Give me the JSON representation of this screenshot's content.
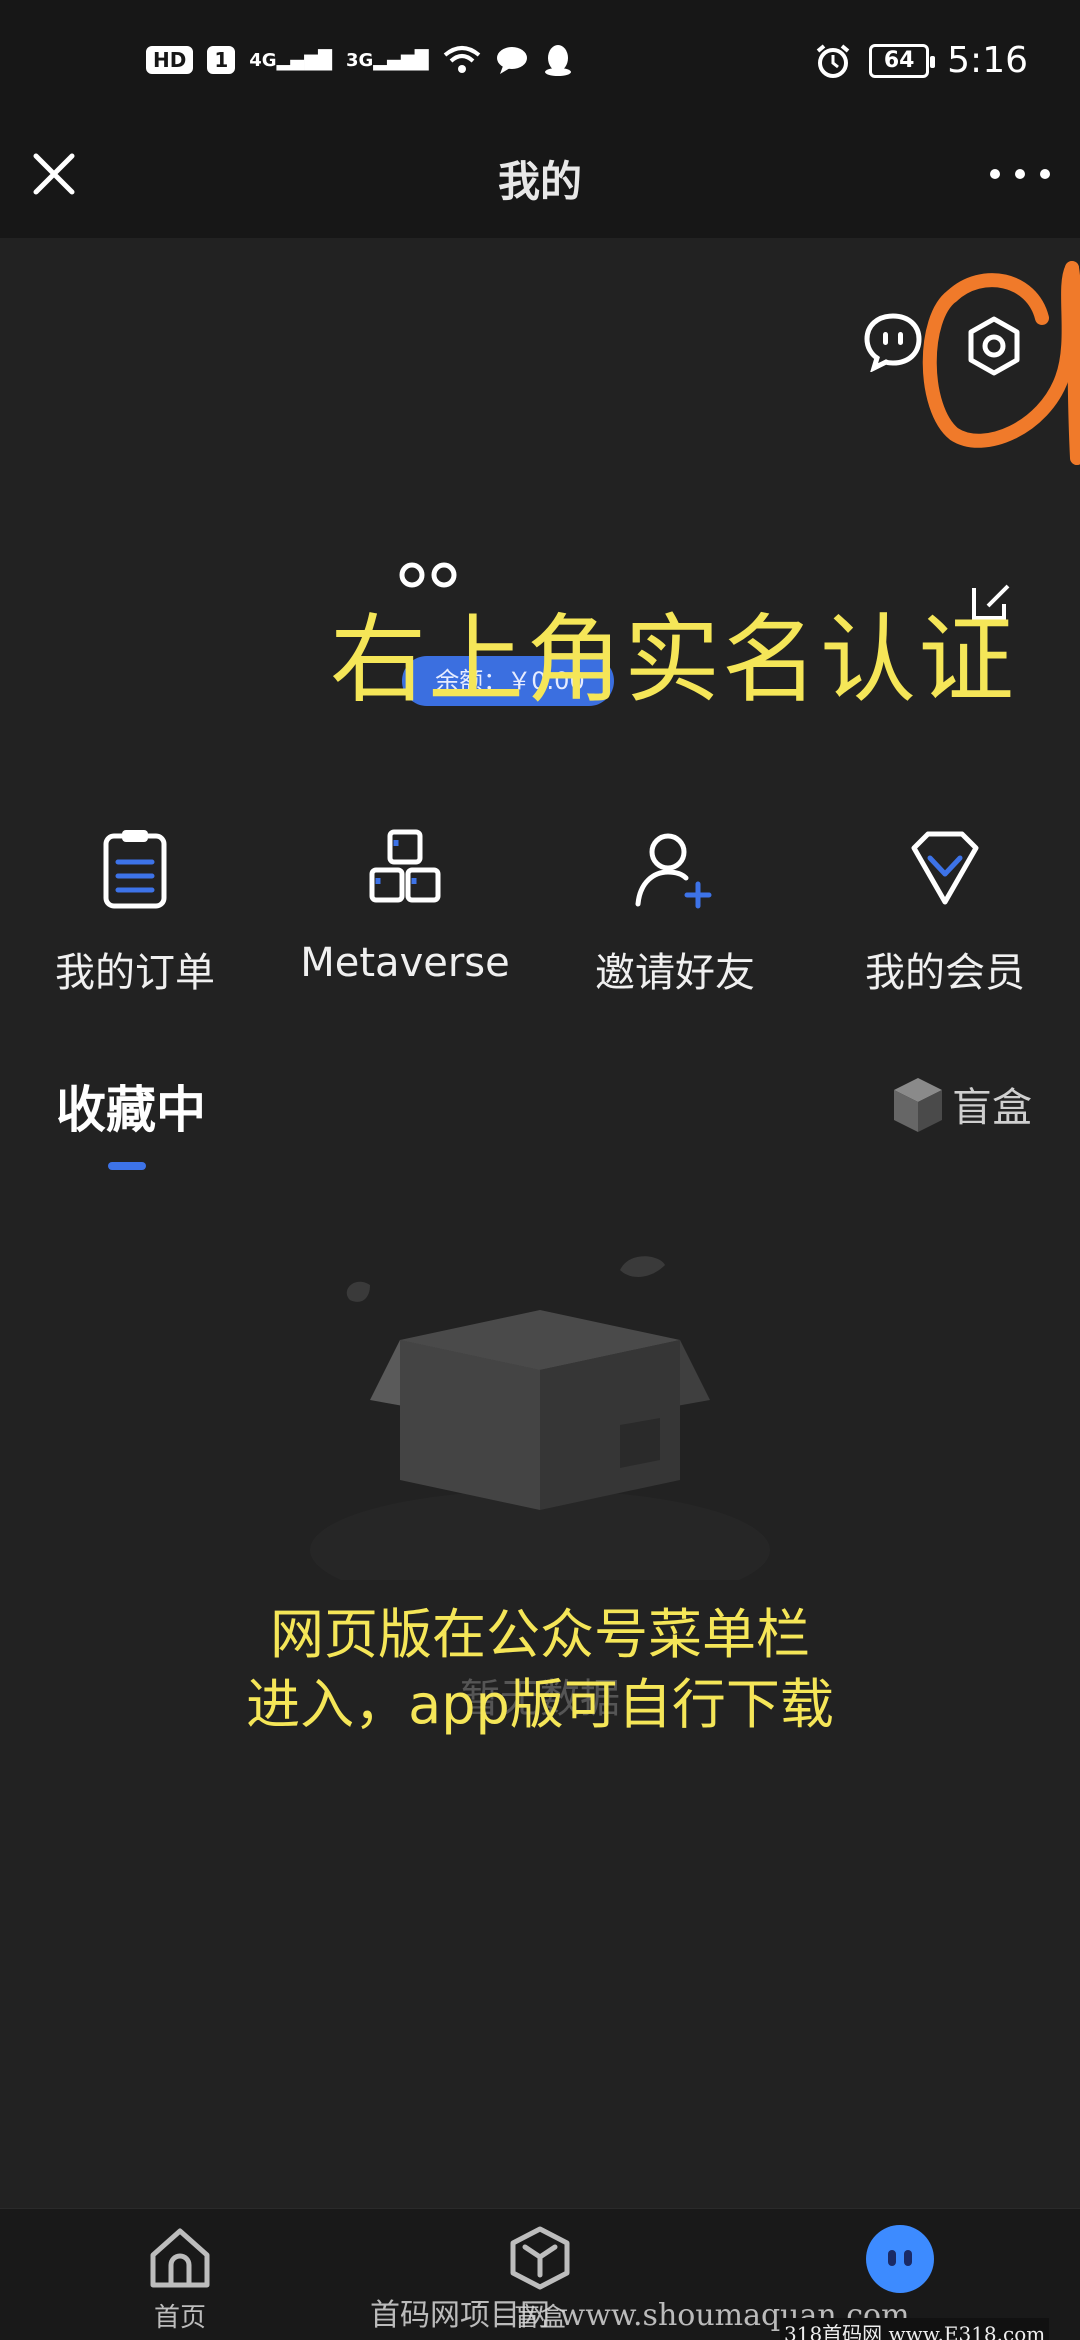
{
  "status_bar": {
    "hd": "HD",
    "sim": "1",
    "net1": "4G",
    "net2": "3G",
    "battery": "64",
    "time": "5:16"
  },
  "header": {
    "title": "我的"
  },
  "profile": {
    "balance": "余额：￥0.00"
  },
  "annotations": {
    "top": "右上角实名认证",
    "bottom_line1": "网页版在公众号菜单栏",
    "bottom_line2": "进入，app版可自行下载"
  },
  "menu": {
    "items": [
      {
        "label": "我的订单",
        "icon": "clipboard-icon"
      },
      {
        "label": "Metaverse",
        "icon": "cubes-icon"
      },
      {
        "label": "邀请好友",
        "icon": "add-user-icon"
      },
      {
        "label": "我的会员",
        "icon": "diamond-icon"
      }
    ]
  },
  "collection": {
    "tab_label": "收藏中",
    "blindbox_label": "盲盒",
    "empty_text": "暂无数据"
  },
  "bottom_nav": {
    "items": [
      {
        "label": "首页",
        "icon": "home-icon"
      },
      {
        "label": "盲盒",
        "icon": "blindbox-icon"
      },
      {
        "label": "",
        "icon": "avatar-icon"
      }
    ]
  },
  "watermark": {
    "text1": "首码网项目网 www.shoumaquan.com",
    "text2": "318首码网 www.E318.com"
  },
  "colors": {
    "accent": "#3d73e8",
    "annotation": "#f5e658",
    "mark": "#f07a2a"
  }
}
